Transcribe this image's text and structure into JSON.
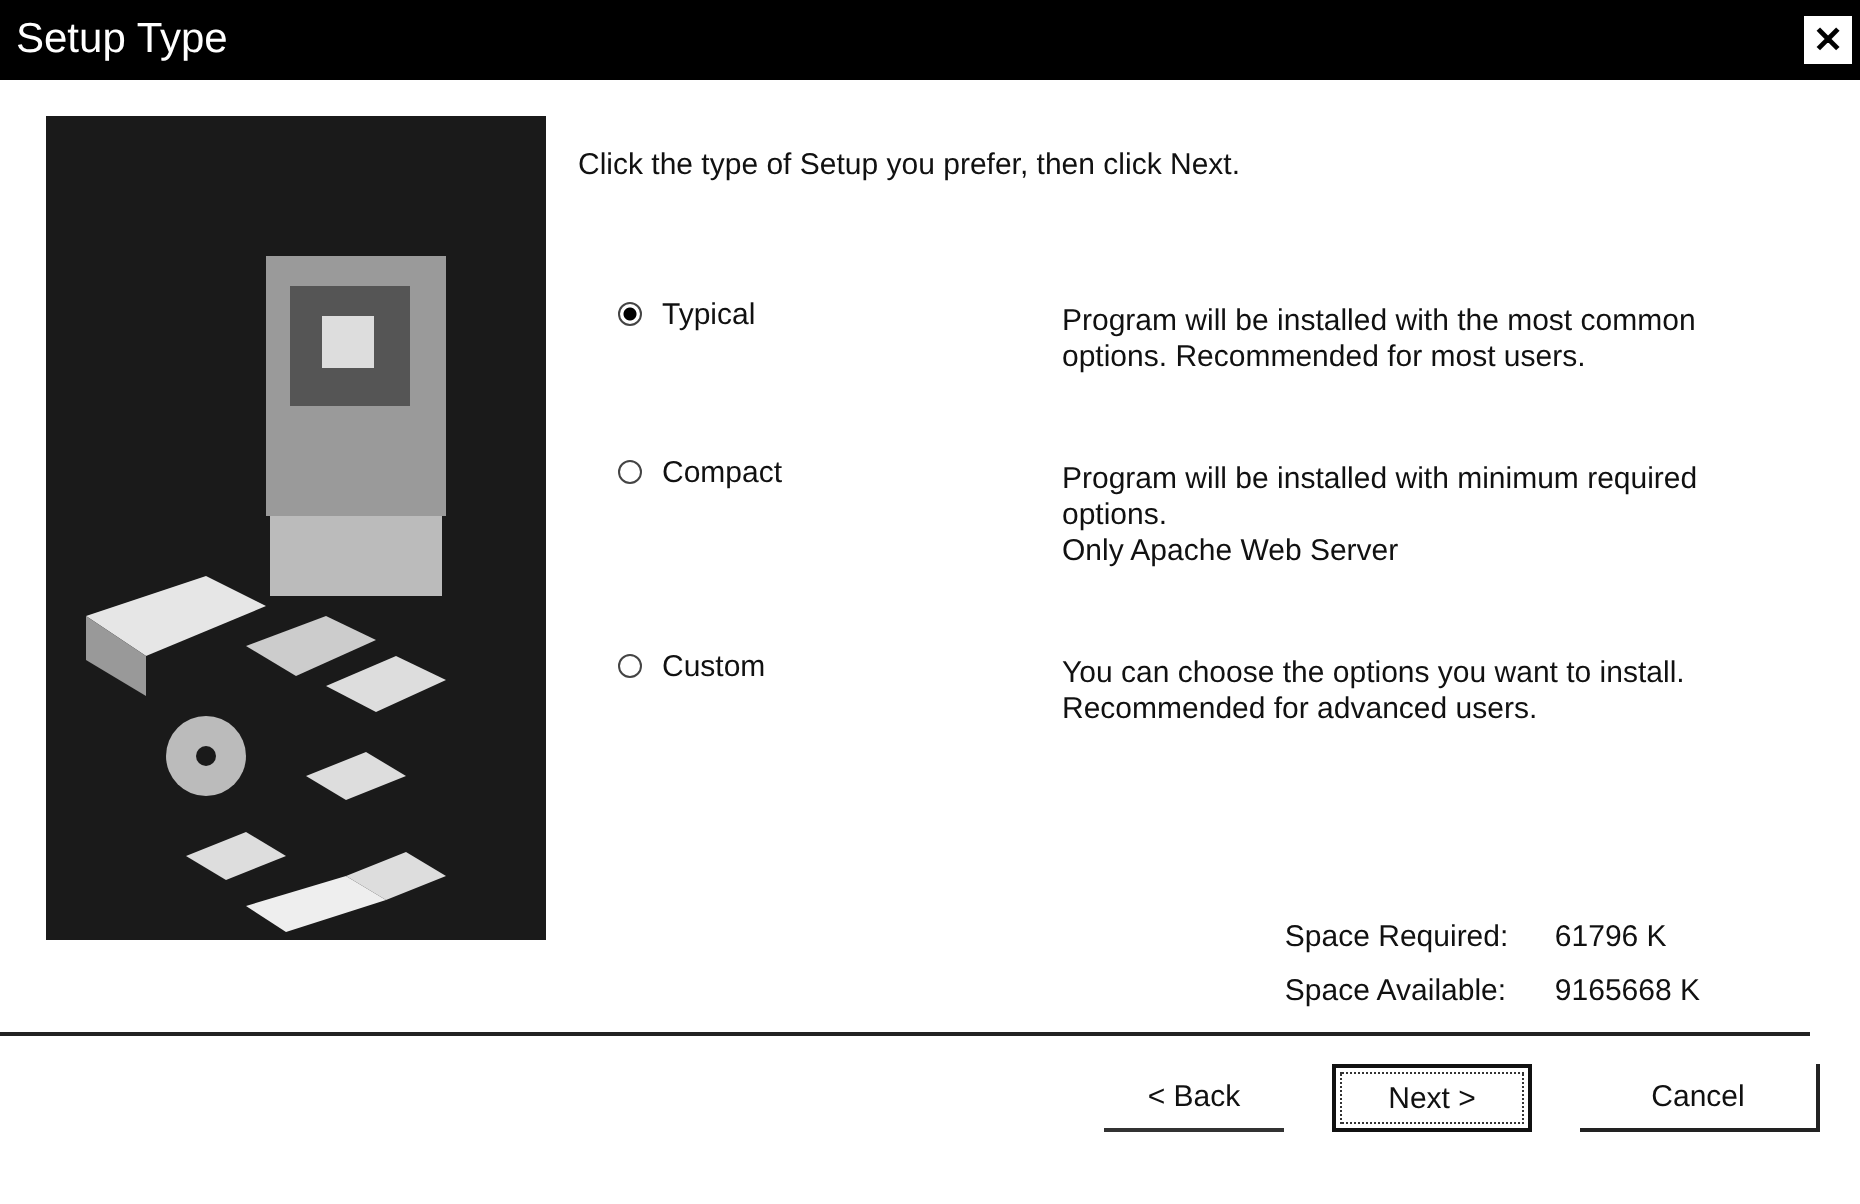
{
  "window": {
    "title": "Setup Type",
    "close_glyph": "✕"
  },
  "instruction": "Click the type of Setup you prefer, then click Next.",
  "options": [
    {
      "label": "Typical",
      "selected": true,
      "description": [
        "Program will be installed with the most common",
        "options. Recommended for most users."
      ]
    },
    {
      "label": "Compact",
      "selected": false,
      "description": [
        "Program will be installed with minimum required",
        "options.",
        "Only Apache Web Server"
      ]
    },
    {
      "label": "Custom",
      "selected": false,
      "description": [
        "You can choose the options you want to install.",
        "Recommended for advanced users."
      ]
    }
  ],
  "space": [
    {
      "label": "Space Required:",
      "value": "61796 K"
    },
    {
      "label": "Space Available:",
      "value": "9165668 K"
    }
  ],
  "buttons": [
    {
      "label": "< Back",
      "kind": "flat",
      "default": false
    },
    {
      "label": "Next >",
      "kind": "framed",
      "default": true
    },
    {
      "label": "Cancel",
      "kind": "raised",
      "default": false
    }
  ]
}
